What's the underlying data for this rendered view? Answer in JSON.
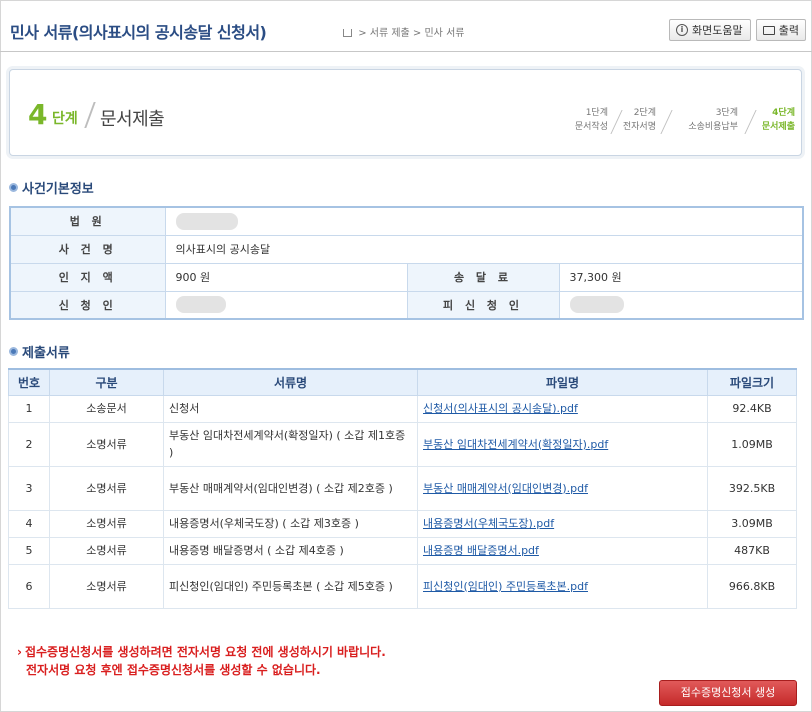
{
  "header": {
    "title": "민사 서류(의사표시의 공시송달 신청서)",
    "breadcrumb": [
      "서류 제출",
      "민사 서류"
    ],
    "help_label": "화면도움말",
    "print_label": "출력"
  },
  "step": {
    "number": "4",
    "unit": "단계",
    "name": "문서제출",
    "steps": [
      {
        "label": "1단계",
        "sub": "문서작성"
      },
      {
        "label": "2단계",
        "sub": "전자서명"
      },
      {
        "label": "3단계",
        "sub": "소송비용납부"
      },
      {
        "label": "4단계",
        "sub": "문서제출"
      }
    ]
  },
  "case_info": {
    "title": "사건기본정보",
    "court_label": "법 원",
    "case_name_label": "사 건 명",
    "case_name": "의사표시의 공시송달",
    "stamp_fee_label": "인 지 액",
    "stamp_fee": "900 원",
    "service_fee_label": "송 달 료",
    "service_fee": "37,300 원",
    "applicant_label": "신 청 인",
    "respondent_label": "피 신 청 인"
  },
  "documents": {
    "title": "제출서류",
    "columns": [
      "번호",
      "구분",
      "서류명",
      "파일명",
      "파일크기"
    ],
    "rows": [
      {
        "no": "1",
        "type": "소송문서",
        "name": "신청서",
        "file": "신청서(의사표시의 공시송달).pdf",
        "size": "92.4KB"
      },
      {
        "no": "2",
        "type": "소명서류",
        "name": "부동산 임대차전세계약서(확정일자) ( 소갑 제1호증 )",
        "file": "부동산 임대차전세계약서(확정일자).pdf",
        "size": "1.09MB"
      },
      {
        "no": "3",
        "type": "소명서류",
        "name": "부동산 매매계약서(임대인변경) ( 소갑 제2호증 )",
        "file": "부동산 매매계약서(임대인변경).pdf",
        "size": "392.5KB"
      },
      {
        "no": "4",
        "type": "소명서류",
        "name": "내용증명서(우체국도장) ( 소갑 제3호증 )",
        "file": "내용증명서(우체국도장).pdf",
        "size": "3.09MB"
      },
      {
        "no": "5",
        "type": "소명서류",
        "name": "내용증명 배달증명서 ( 소갑 제4호증 )",
        "file": "내용증명 배달증명서.pdf",
        "size": "487KB"
      },
      {
        "no": "6",
        "type": "소명서류",
        "name": "피신청인(임대인) 주민등록초본 ( 소갑 제5호증 )",
        "file": "피신청인(임대인) 주민등록초본.pdf",
        "size": "966.8KB"
      }
    ]
  },
  "notice": {
    "line1": "접수증명신청서를 생성하려면 전자서명 요청 전에 생성하시기 바랍니다.",
    "line2": "전자서명 요청 후엔 접수증명신청서를 생성할 수 없습니다."
  },
  "generate_button": "접수증명신청서 생성"
}
